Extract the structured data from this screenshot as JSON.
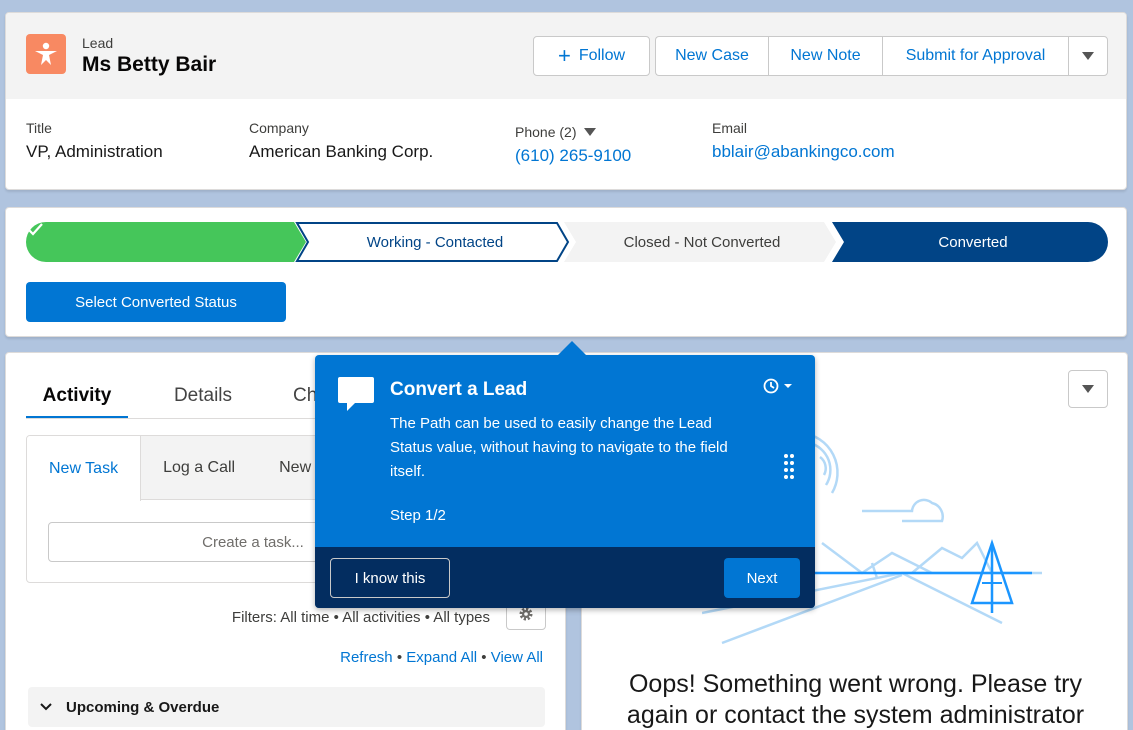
{
  "header": {
    "object_label": "Lead",
    "record_name": "Ms Betty Bair",
    "follow_label": "Follow",
    "actions": [
      "New Case",
      "New Note",
      "Submit for Approval"
    ]
  },
  "fields": {
    "title": {
      "label": "Title",
      "value": "VP, Administration"
    },
    "company": {
      "label": "Company",
      "value": "American Banking Corp."
    },
    "phone": {
      "label": "Phone (2)",
      "value": "(610) 265-9100"
    },
    "email": {
      "label": "Email",
      "value": "bblair@abankingco.com"
    }
  },
  "path": {
    "stages": [
      {
        "label": "",
        "state": "complete"
      },
      {
        "label": "Working - Contacted",
        "state": "current"
      },
      {
        "label": "Closed - Not Converted",
        "state": "incomplete"
      },
      {
        "label": "Converted",
        "state": "selected"
      }
    ],
    "button_label": "Select Converted Status",
    "colors": {
      "complete": "#45c65a",
      "current_border": "#014486",
      "incomplete": "#f3f3f3",
      "selected": "#014486"
    }
  },
  "activity": {
    "tabs": [
      "Activity",
      "Details",
      "Ch"
    ],
    "composer_tabs": [
      "New Task",
      "Log a Call",
      "New E"
    ],
    "task_placeholder": "Create a task...",
    "filters": "Filters: All time • All activities • All types",
    "links": [
      "Refresh",
      "Expand All",
      "View All"
    ],
    "upcoming": "Upcoming & Overdue"
  },
  "right_panel": {
    "error": "Oops! Something went wrong. Please try again or contact the system administrator"
  },
  "popover": {
    "title": "Convert a Lead",
    "body": "The Path can be used to easily change the Lead Status value, without having to navigate to the field itself.",
    "step": "Step 1/2",
    "dismiss_label": "I know this",
    "next_label": "Next"
  }
}
